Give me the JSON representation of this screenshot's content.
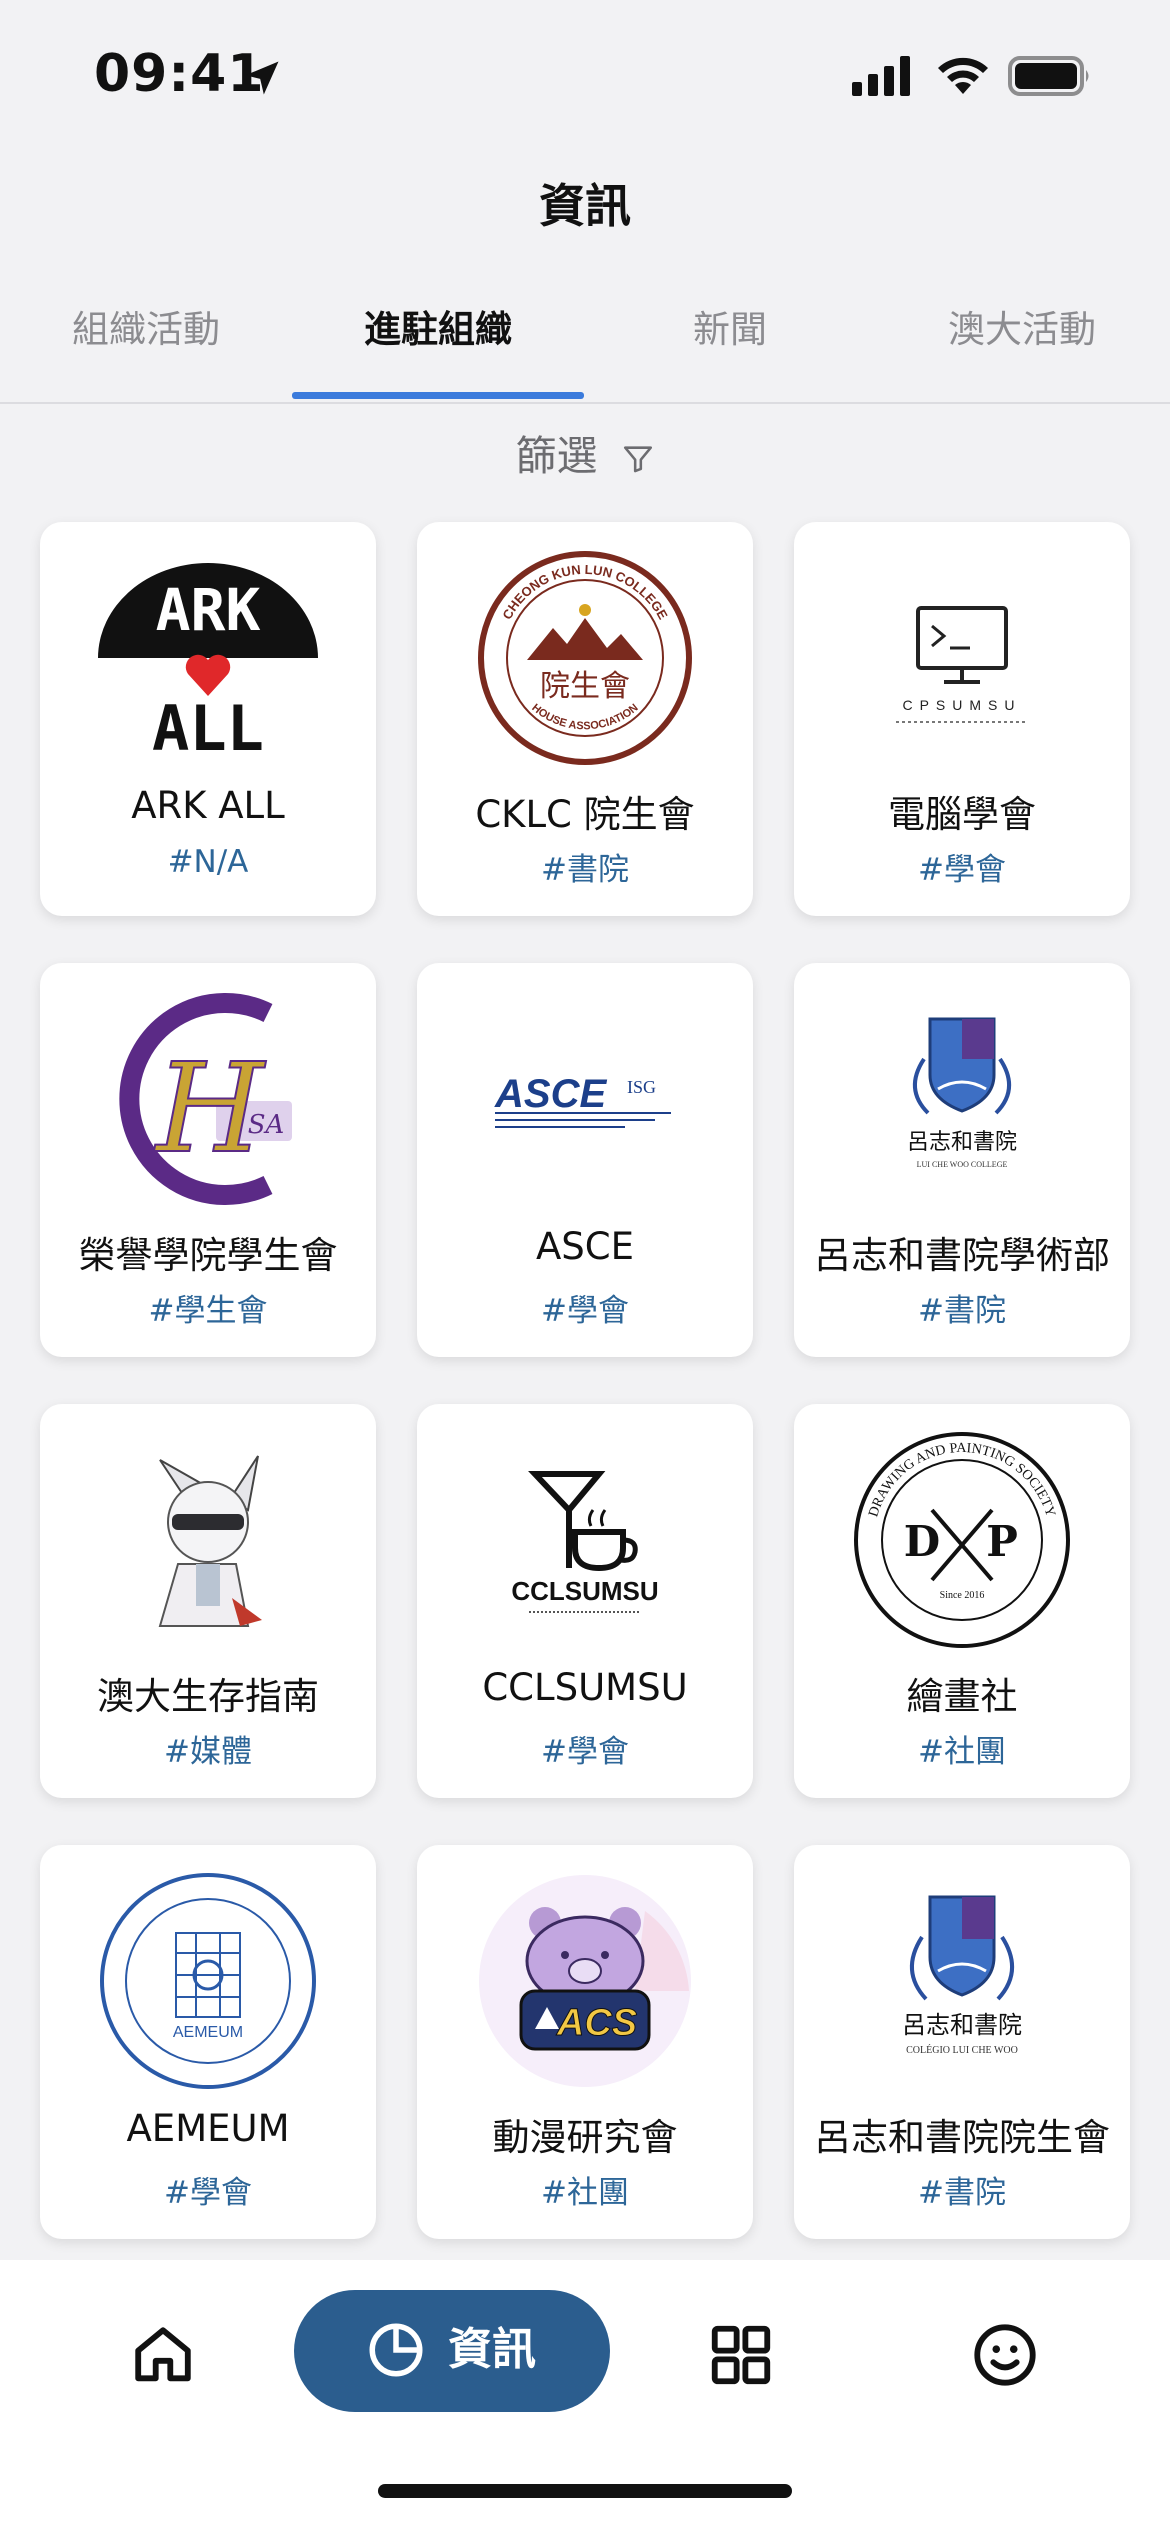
{
  "status_bar": {
    "time": "09:41"
  },
  "header": {
    "title": "資訊"
  },
  "tabs": [
    {
      "label": "組織活動"
    },
    {
      "label": "進駐組織"
    },
    {
      "label": "新聞"
    },
    {
      "label": "澳大活動"
    }
  ],
  "active_tab": "進駐組織",
  "filter": {
    "label": "篩選"
  },
  "organizations": [
    {
      "name": "ARK ALL",
      "tag": "#N/A",
      "logo_text_1": "ARK",
      "logo_text_2": "ALL"
    },
    {
      "name": "CKLC 院生會",
      "tag": "#書院",
      "logo_text_1": "CHEONG KUN LUN COLLEGE",
      "logo_text_2": "院生會",
      "logo_text_3": "HOUSE ASSOCIATION"
    },
    {
      "name": "電腦學會",
      "tag": "#學會",
      "logo_text_1": "CPSUMSU"
    },
    {
      "name": "榮譽學院學生會",
      "tag": "#學生會",
      "logo_text_1": "H",
      "logo_text_2": "SA"
    },
    {
      "name": "ASCE",
      "tag": "#學會",
      "logo_text_1": "ASCE",
      "logo_text_2": "ISG"
    },
    {
      "name": "呂志和書院學術部",
      "tag": "#書院",
      "logo_text_1": "呂志和書院",
      "logo_text_2": "LUI CHE WOO COLLEGE"
    },
    {
      "name": "澳大生存指南",
      "tag": "#媒體"
    },
    {
      "name": "CCLSUMSU",
      "tag": "#學會",
      "logo_text_1": "CCLSUMSU"
    },
    {
      "name": "繪畫社",
      "tag": "#社團",
      "logo_text_1": "DRAWING AND PAINTING SOCIETY",
      "logo_text_2": "D",
      "logo_text_3": "P",
      "logo_text_4": "Since 2016"
    },
    {
      "name": "AEMEUM",
      "tag": "#學會",
      "logo_text_1": "AEMEUM"
    },
    {
      "name": "動漫研究會",
      "tag": "#社團",
      "logo_text_1": "ACS"
    },
    {
      "name": "呂志和書院院生會",
      "tag": "#書院",
      "logo_text_1": "呂志和書院",
      "logo_text_2": "COLÉGIO LUI CHE WOO"
    }
  ],
  "bottom_nav": {
    "home_icon": "home-icon",
    "active_label": "資訊",
    "apps_icon": "grid-icon",
    "profile_icon": "smiley-icon"
  },
  "colors": {
    "accent": "#3b7bdc",
    "tag": "#2d6698",
    "nav_active": "#2b5d8e",
    "ckl_maroon": "#7a2a1e"
  }
}
